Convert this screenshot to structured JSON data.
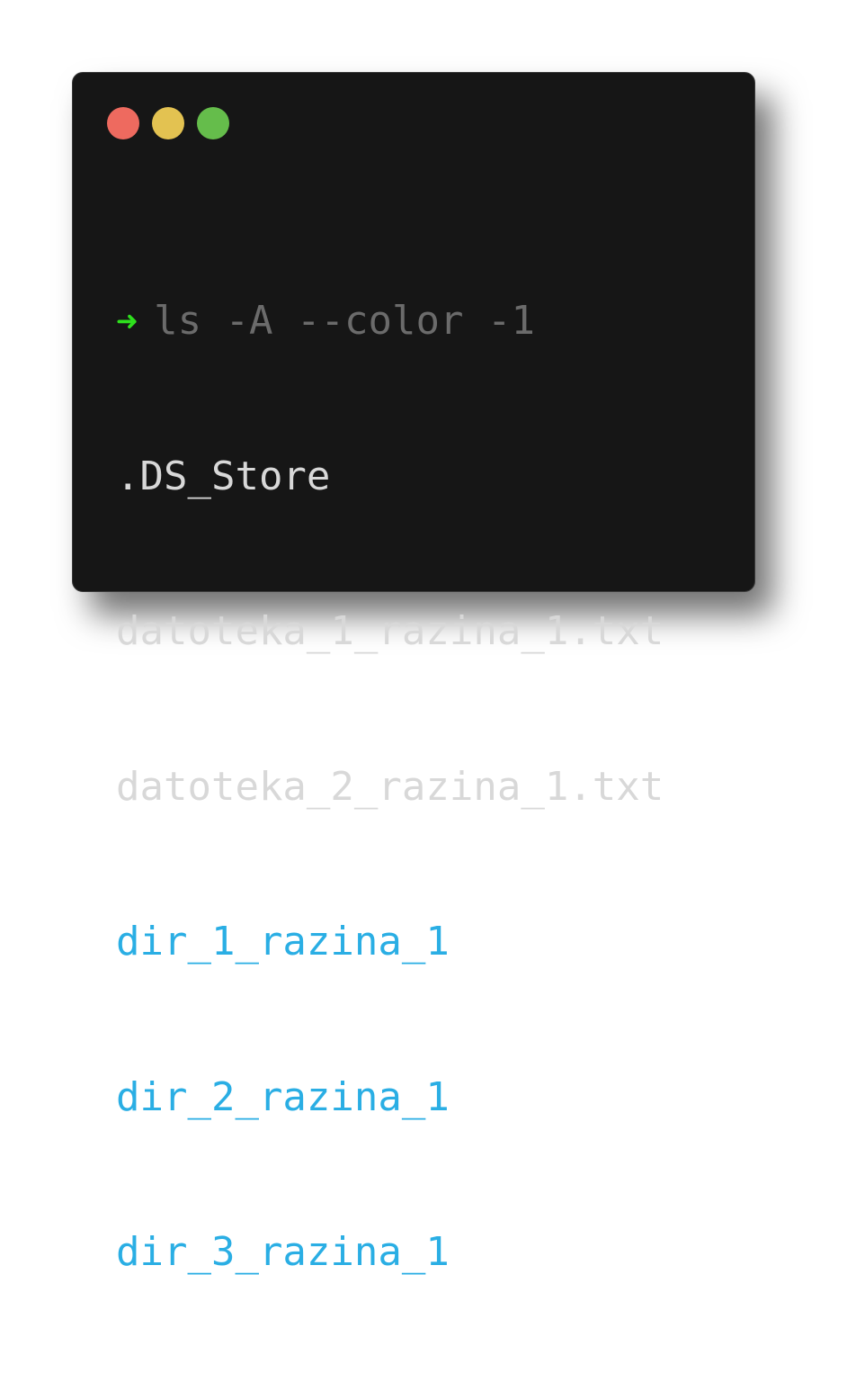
{
  "window": {
    "buttons": [
      {
        "name": "close",
        "color": "#ee6a5f"
      },
      {
        "name": "minimize",
        "color": "#e3c251"
      },
      {
        "name": "maximize",
        "color": "#65bd4b"
      }
    ],
    "background": "#161616"
  },
  "terminal": {
    "prompt_symbol": "➜",
    "prompt_color": "#2ee01d",
    "command": "ls -A --color -1",
    "command_color": "#6b6b6b",
    "file_color": "#d8d8d8",
    "dir_color": "#2aaee4",
    "output": [
      {
        "text": ".DS_Store",
        "kind": "file"
      },
      {
        "text": "datoteka_1_razina_1.txt",
        "kind": "file"
      },
      {
        "text": "datoteka_2_razina_1.txt",
        "kind": "file"
      },
      {
        "text": "dir_1_razina_1",
        "kind": "dir"
      },
      {
        "text": "dir_2_razina_1",
        "kind": "dir"
      },
      {
        "text": "dir_3_razina_1",
        "kind": "dir"
      }
    ]
  }
}
